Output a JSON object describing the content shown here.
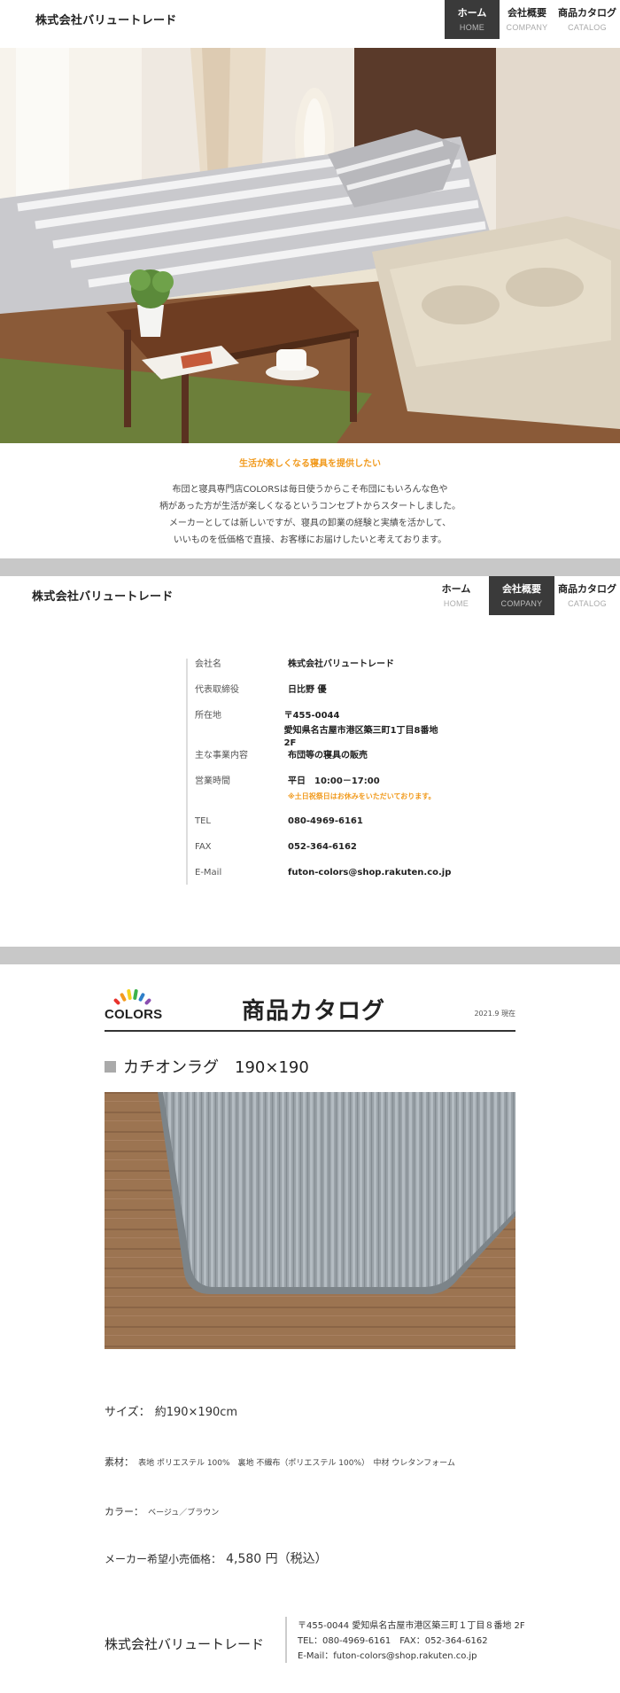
{
  "header_top": {
    "company_name": "株式会社バリュートレード",
    "nav": [
      {
        "ja": "ホーム",
        "en": "HOME"
      },
      {
        "ja": "会社概要",
        "en": "COMPANY"
      },
      {
        "ja": "商品カタログ",
        "en": "CATALOG"
      }
    ]
  },
  "intro": {
    "tagline": "生活が楽しくなる寝具を提供したい",
    "lines": [
      "布団と寝具専門店COLORSは毎日使うからこそ布団にもいろんな色や",
      "柄があった方が生活が楽しくなるというコンセプトからスタートしました。",
      "メーカーとしては新しいですが、寝具の卸業の経験と実績を活かして、",
      "いいものを低価格で直接、お客様にお届けしたいと考えております。"
    ]
  },
  "header_company": {
    "company_name": "株式会社バリュートレード",
    "nav": [
      {
        "ja": "ホーム",
        "en": "HOME"
      },
      {
        "ja": "会社概要",
        "en": "COMPANY"
      },
      {
        "ja": "商品カタログ",
        "en": "CATALOG"
      }
    ]
  },
  "company_info": [
    {
      "key": "会社名",
      "value": "株式会社バリュートレード"
    },
    {
      "key": "代表取締役",
      "value": "日比野 優"
    },
    {
      "key": "所在地",
      "value": "〒455-0044",
      "value2": "愛知県名古屋市港区築三町1丁目8番地　2F"
    },
    {
      "key": "主な事業内容",
      "value": "布団等の寝具の販売"
    },
    {
      "key": "営業時間",
      "value": "平日　10:00－17:00",
      "note": "※土日祝祭日はお休みをいただいております。"
    },
    {
      "key": "TEL",
      "value": "080-4969-6161"
    },
    {
      "key": "FAX",
      "value": "052-364-6162"
    },
    {
      "key": "E-Mail",
      "value": "futon-colors@shop.rakuten.co.jp"
    }
  ],
  "catalog": {
    "logo_text": "COLORS",
    "title": "商品カタログ",
    "date": "2021.9 現在",
    "logo_colors": [
      "#e8322c",
      "#f39a1e",
      "#f5d21c",
      "#3bb24a",
      "#2f7fc9",
      "#8a4db0"
    ],
    "product_title": "カチオンラグ　190×190",
    "size_label": "サイズ：",
    "size_value": "約190×190cm",
    "material_label": "素材：",
    "material_value": "表地 ポリエステル 100%　裏地 不織布（ポリエステル 100%）　中材 ウレタンフォーム",
    "color_label": "カラー：",
    "color_value": "ベージュ／ブラウン",
    "price_label": "メーカー希望小売価格：",
    "price_value": "4,580 円（税込）"
  },
  "footer": {
    "company_name": "株式会社バリュートレード",
    "address": "〒455-0044 愛知県名古屋市港区築三町１丁目８番地  2F",
    "tel_fax": "TEL：080-4969-6161　FAX：052-364-6162",
    "email": "E-Mail：futon-colors@shop.rakuten.co.jp"
  }
}
